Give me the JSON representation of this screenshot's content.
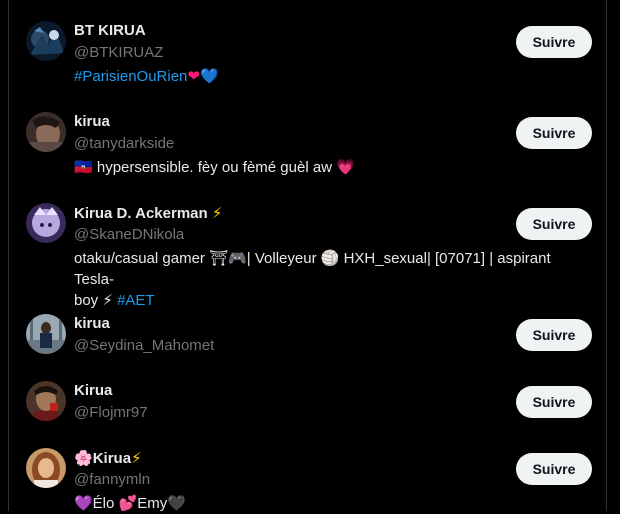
{
  "follow_label": "Suivre",
  "colors": {
    "background": "#000000",
    "name": "#e7e9ea",
    "handle": "#71767b",
    "link": "#1d9bf0",
    "button_bg": "#eff3f4",
    "button_text": "#0f1419"
  },
  "users": [
    {
      "name": "BT KIRUA",
      "handle": "@BTKIRUAZ",
      "bio_tag": "#ParisienOuRien",
      "bio_emoji": "❤💙"
    },
    {
      "name": "kirua",
      "handle": "@tanydarkside",
      "bio_flag": "🇭🇹",
      "bio_text": "hypersensible. fèy ou fèmé guèl aw",
      "bio_emoji": "💗"
    },
    {
      "name": "Kirua D. Ackerman",
      "name_emoji": "⚡",
      "handle": "@SkaneDNikola",
      "bio_line1": "otaku/casual gamer ⛩🎮| Volleyeur 🏐 HXH_sexual| [07071] | aspirant Tesla-",
      "bio_line2_text": "boy ⚡ ",
      "bio_tag": "#AET"
    },
    {
      "name": "kirua",
      "handle": "@Seydina_Mahomet"
    },
    {
      "name": "Kirua",
      "handle": "@Flojmr97"
    },
    {
      "name": "Kirua",
      "name_prefix_emoji": "🌸",
      "name_emoji": "⚡",
      "handle": "@fannymln",
      "bio_line": "💜Élo 💕Emy🖤"
    }
  ]
}
